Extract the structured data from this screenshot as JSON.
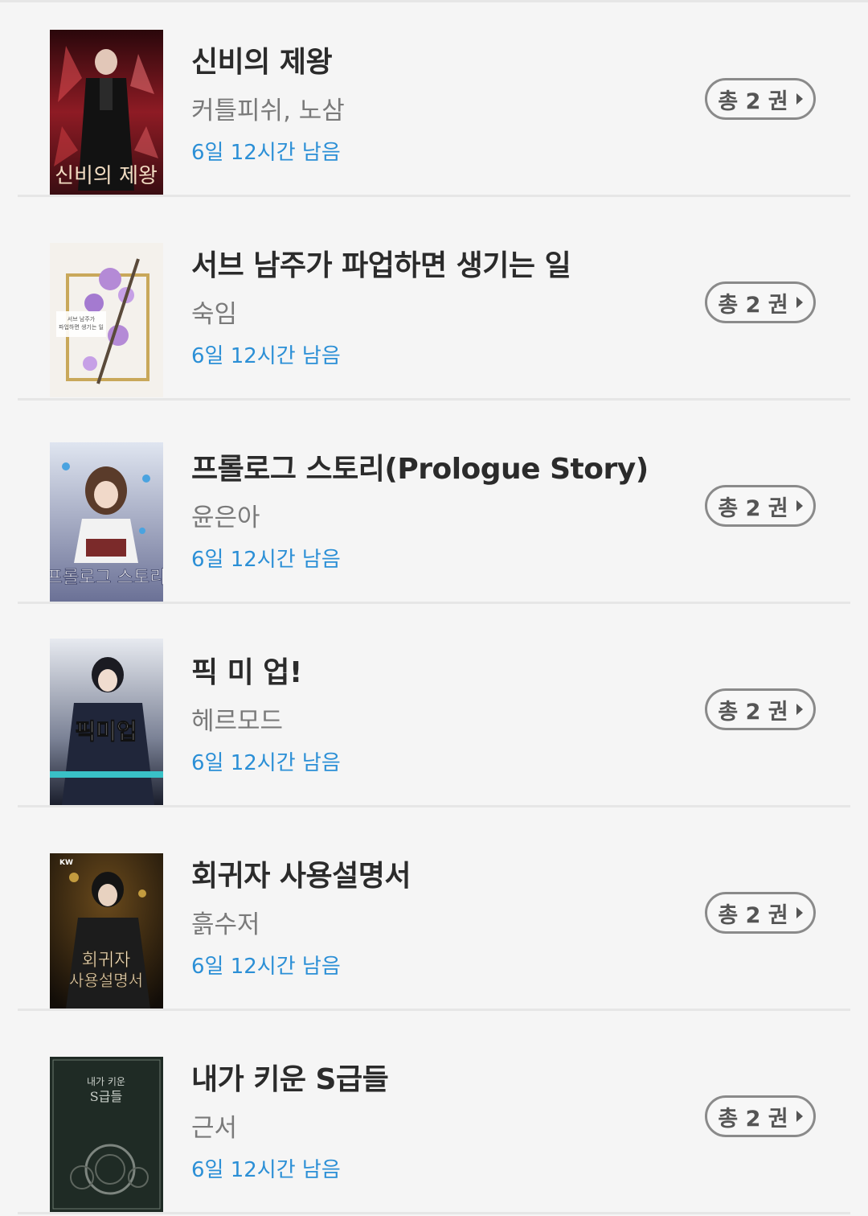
{
  "books": [
    {
      "title": "신비의 제왕",
      "author": "커틀피쉬, 노삼",
      "remaining": "6일 12시간 남음",
      "volumes": "총 2 권",
      "cover_text": "신비의 제왕",
      "cover_colors": [
        "#3a0d12",
        "#b3262f"
      ]
    },
    {
      "title": "서브 남주가 파업하면 생기는 일",
      "author": "숙임",
      "remaining": "6일 12시간 남음",
      "volumes": "총 2 권",
      "cover_text": "서브 남주가 파업하면 생기는 일",
      "cover_colors": [
        "#f3efe9",
        "#b48ad6"
      ]
    },
    {
      "title": "프롤로그 스토리(Prologue Story)",
      "author": "윤은아",
      "remaining": "6일 12시간 남음",
      "volumes": "총 2 권",
      "cover_text": "프롤로그 스토리",
      "cover_colors": [
        "#cfd6e6",
        "#4a4f7a"
      ]
    },
    {
      "title": "픽 미 업!",
      "author": "헤르모드",
      "remaining": "6일 12시간 남음",
      "volumes": "총 2 권",
      "cover_text": "픽미업",
      "cover_colors": [
        "#dfe3ea",
        "#1d2233"
      ]
    },
    {
      "title": "회귀자 사용설명서",
      "author": "흙수저",
      "remaining": "6일 12시간 남음",
      "volumes": "총 2 권",
      "cover_text": "회귀자 사용설명서",
      "cover_colors": [
        "#1a140d",
        "#b08a3a"
      ]
    },
    {
      "title": "내가 키운 S급들",
      "author": "근서",
      "remaining": "6일 12시간 남음",
      "volumes": "총 2 권",
      "cover_text": "내가 키운 S급들",
      "cover_colors": [
        "#1d2a24",
        "#4b5a4f"
      ]
    }
  ]
}
